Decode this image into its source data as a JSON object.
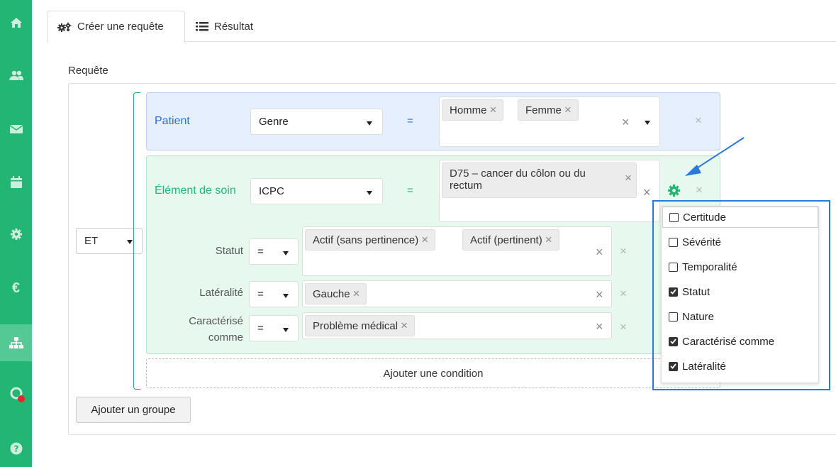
{
  "tabs": [
    {
      "label": "Créer une requête",
      "icon": "gears-icon"
    },
    {
      "label": "Résultat",
      "icon": "list-icon"
    }
  ],
  "query_label": "Requête",
  "operator": "ET",
  "patient": {
    "label": "Patient",
    "field": "Genre",
    "eq": "=",
    "values": [
      "Homme",
      "Femme"
    ]
  },
  "soin": {
    "label": "Élément de soin",
    "field": "ICPC",
    "eq": "=",
    "value_line1": "D75 – cancer du côlon ou du",
    "value_line2": "rectum",
    "conditions": {
      "statut": {
        "label": "Statut",
        "op": "=",
        "values": [
          "Actif (sans pertinence)",
          "Actif (pertinent)"
        ]
      },
      "lateralite": {
        "label": "Latéralité",
        "op": "=",
        "values": [
          "Gauche"
        ]
      },
      "caracterise": {
        "label_line1": "Caractérisé",
        "label_line2": "comme",
        "op": "=",
        "values": [
          "Problème médical"
        ]
      }
    }
  },
  "add_condition": "Ajouter une condition",
  "add_group": "Ajouter un groupe",
  "dropdown_options": [
    {
      "label": "Certitude",
      "checked": false
    },
    {
      "label": "Sévérité",
      "checked": false
    },
    {
      "label": "Temporalité",
      "checked": false
    },
    {
      "label": "Statut",
      "checked": true
    },
    {
      "label": "Nature",
      "checked": false
    },
    {
      "label": "Caractérisé comme",
      "checked": true
    },
    {
      "label": "Latéralité",
      "checked": true
    }
  ],
  "colors": {
    "brand": "#22b573",
    "blue": "#2c6fdc",
    "highlight": "#2a7ad8"
  }
}
